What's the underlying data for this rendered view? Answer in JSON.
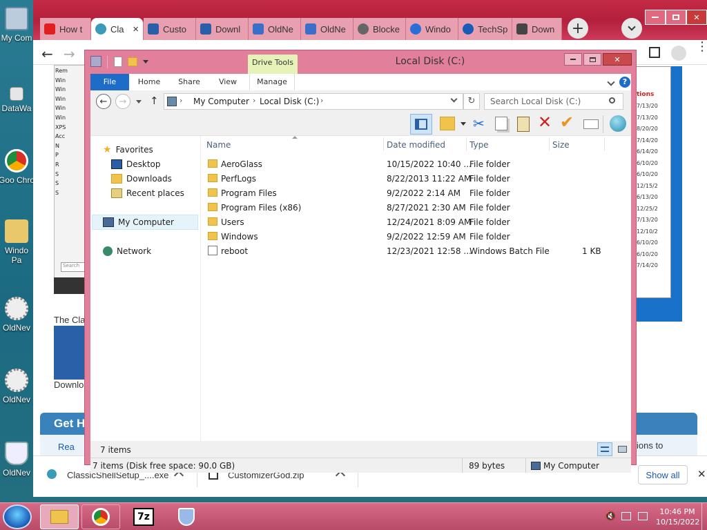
{
  "desktop": {
    "icons": [
      {
        "label": "My Com",
        "icon": "computer-icon"
      },
      {
        "label": "DataWa",
        "icon": "shortcut-icon"
      },
      {
        "label": "Goo Chro",
        "icon": "chrome-icon"
      },
      {
        "label": "Windo Pa",
        "icon": "folder-icon"
      },
      {
        "label": "OldNev",
        "icon": "gear-icon"
      },
      {
        "label": "OldNev",
        "icon": "gear-icon"
      },
      {
        "label": "OldNev",
        "icon": "shield-icon"
      }
    ]
  },
  "browser": {
    "tabs": [
      {
        "label": "How t",
        "color": "#e02020"
      },
      {
        "label": "Cla",
        "color": "#3a9bb8",
        "active": true
      },
      {
        "label": "Custo",
        "color": "#2a5ea8"
      },
      {
        "label": "Downl",
        "color": "#2a5ea8"
      },
      {
        "label": "OldNe",
        "color": "#3a6ec8"
      },
      {
        "label": "OldNe",
        "color": "#3a6ec8"
      },
      {
        "label": "Blocke",
        "color": "#666666"
      },
      {
        "label": "Windo",
        "color": "#2a6ed8"
      },
      {
        "label": "TechSp",
        "color": "#1a5ab8"
      },
      {
        "label": "Down",
        "color": "#444444"
      }
    ],
    "close_tab": "×",
    "new_tab": "+",
    "page": {
      "frag_text_1": "The Cla",
      "frag_text_2": "Downlo",
      "section_heading": "Get H",
      "bullet_text": "Rea",
      "right_text": "ions to",
      "sidebar_items": [
        "Rem",
        "Win",
        "Win",
        "Win",
        "Win",
        "Win",
        "XPS",
        "Acc",
        "",
        "",
        "N",
        "P",
        "R",
        "S",
        "S",
        "S"
      ],
      "dates": [
        "7/13/20",
        "7/13/20",
        "8/20/20",
        "7/14/20",
        "6/14/20",
        "6/10/20",
        "6/10/20",
        "12/15/2",
        "6/13/20",
        "12/25/2",
        "7/13/20",
        "12/10/2",
        "6/10/20",
        "6/10/20",
        "7/14/20"
      ],
      "red_header": "tions",
      "search_placeholder": "Search"
    },
    "downloads": {
      "items": [
        {
          "name": "ClassicShellSetup_....exe"
        },
        {
          "name": "CustomizerGod.zip"
        }
      ],
      "show_all": "Show all",
      "close": "✕"
    }
  },
  "explorer": {
    "title": "Local Disk (C:)",
    "context_tab": "Drive Tools",
    "ribbon_tabs": [
      "File",
      "Home",
      "Share",
      "View",
      "Manage"
    ],
    "breadcrumb": [
      "My Computer",
      "Local Disk (C:)"
    ],
    "search_placeholder": "Search Local Disk (C:)",
    "nav": {
      "favorites": "Favorites",
      "desktop": "Desktop",
      "downloads": "Downloads",
      "recent": "Recent places",
      "computer": "My Computer",
      "network": "Network"
    },
    "columns": [
      "Name",
      "Date modified",
      "Type",
      "Size"
    ],
    "files": [
      {
        "name": "AeroGlass",
        "date": "10/15/2022 10:40 ...",
        "type": "File folder",
        "size": "",
        "kind": "folder"
      },
      {
        "name": "PerfLogs",
        "date": "8/22/2013 11:22 AM",
        "type": "File folder",
        "size": "",
        "kind": "folder"
      },
      {
        "name": "Program Files",
        "date": "9/2/2022 2:14 AM",
        "type": "File folder",
        "size": "",
        "kind": "folder"
      },
      {
        "name": "Program Files (x86)",
        "date": "8/27/2021 2:30 AM",
        "type": "File folder",
        "size": "",
        "kind": "folder"
      },
      {
        "name": "Users",
        "date": "12/24/2021 8:09 AM",
        "type": "File folder",
        "size": "",
        "kind": "folder"
      },
      {
        "name": "Windows",
        "date": "9/2/2022 12:59 AM",
        "type": "File folder",
        "size": "",
        "kind": "folder"
      },
      {
        "name": "reboot",
        "date": "12/23/2021 12:58 ...",
        "type": "Windows Batch File",
        "size": "1 KB",
        "kind": "batch"
      }
    ],
    "item_count": "7 items",
    "status_left": "7 items (Disk free space: 90.0 GB)",
    "status_size": "89 bytes",
    "status_location": "My Computer"
  },
  "taskbar": {
    "time": "10:46 PM",
    "date": "10/15/2022",
    "sevenzip": "7z"
  }
}
